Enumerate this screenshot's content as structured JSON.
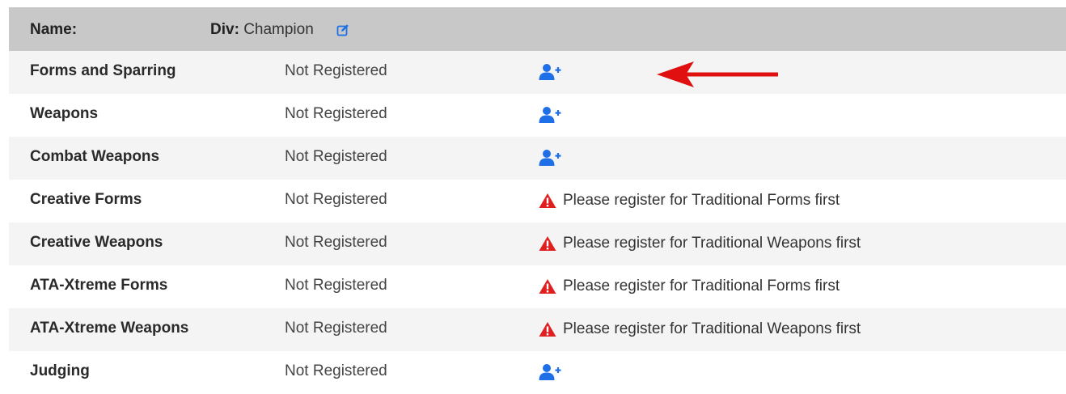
{
  "header": {
    "name_label": "Name:",
    "div_label": "Div:",
    "div_value": "Champion",
    "edit_icon": "edit-icon"
  },
  "colors": {
    "header_bg": "#c8c8c8",
    "accent_blue": "#1e6fe8",
    "warning_red": "#e02020",
    "annotation_arrow": "#e01010"
  },
  "rows": [
    {
      "event": "Forms and Sparring",
      "status": "Not Registered",
      "action": "add",
      "icon": "add-user-icon"
    },
    {
      "event": "Weapons",
      "status": "Not Registered",
      "action": "add",
      "icon": "add-user-icon"
    },
    {
      "event": "Combat Weapons",
      "status": "Not Registered",
      "action": "add",
      "icon": "add-user-icon"
    },
    {
      "event": "Creative Forms",
      "status": "Not Registered",
      "action": "warning",
      "icon": "warning-icon",
      "message": "Please register for Traditional Forms first"
    },
    {
      "event": "Creative Weapons",
      "status": "Not Registered",
      "action": "warning",
      "icon": "warning-icon",
      "message": "Please register for Traditional Weapons first"
    },
    {
      "event": "ATA-Xtreme Forms",
      "status": "Not Registered",
      "action": "warning",
      "icon": "warning-icon",
      "message": "Please register for Traditional Forms first"
    },
    {
      "event": "ATA-Xtreme Weapons",
      "status": "Not Registered",
      "action": "warning",
      "icon": "warning-icon",
      "message": "Please register for Traditional Weapons first"
    },
    {
      "event": "Judging",
      "status": "Not Registered",
      "action": "add",
      "icon": "add-user-icon"
    }
  ],
  "annotation": {
    "icon": "red-arrow-icon"
  }
}
